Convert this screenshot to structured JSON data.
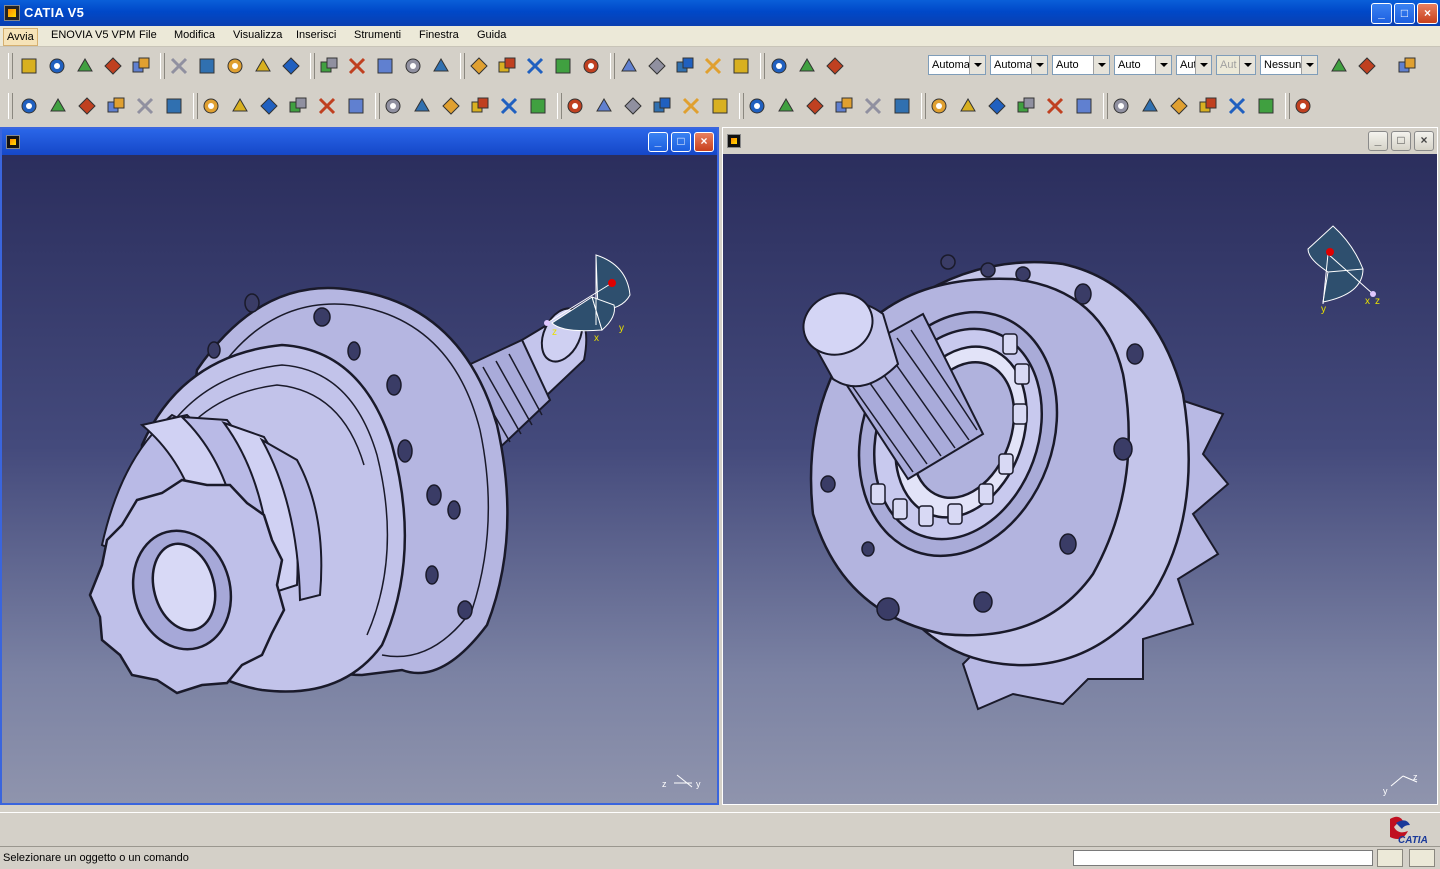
{
  "window": {
    "title": "CATIA V5"
  },
  "menu": {
    "items": [
      "Avvia",
      "ENOVIA V5 VPM",
      "File",
      "Modifica",
      "Visualizza",
      "Inserisci",
      "Strumenti",
      "Finestra",
      "Guida"
    ],
    "active": "Avvia"
  },
  "toolbar1": {
    "icons": [
      "gear-icon",
      "gears-icon",
      "catalog-icon",
      "manikin-icon",
      "manikin-group-icon",
      "new-icon",
      "open-icon",
      "save-icon",
      "print-icon",
      "cut-icon",
      "copy-icon",
      "paste-icon",
      "undo-icon",
      "redo-icon",
      "whats-this-icon",
      "camera-icon",
      "fly-mode-icon",
      "fit-all-icon",
      "pan-icon",
      "rotate-icon",
      "zoom-in-icon",
      "zoom-out-icon",
      "normal-view-icon",
      "multi-view-icon",
      "iso-view-icon",
      "shading-icon",
      "hide-show-icon",
      "swap-visible-icon"
    ],
    "combos": [
      {
        "value": "Automa",
        "disabled": false
      },
      {
        "value": "Automa",
        "disabled": false
      },
      {
        "value": "Auto",
        "disabled": false
      },
      {
        "value": "Auto",
        "disabled": false
      },
      {
        "value": "Aut",
        "disabled": false
      },
      {
        "value": "Aut",
        "disabled": true
      },
      {
        "value": "Nessunc",
        "disabled": false
      }
    ],
    "right_icons": [
      "painter-icon",
      "copy-format-icon",
      "layers-icon"
    ]
  },
  "toolbar2": {
    "icons": [
      "select-icon",
      "sketch-icon",
      "part-body-icon",
      "measure-icon",
      "constraint-icon",
      "bottle-icon",
      "publish-icon",
      "pad-icon",
      "pocket-icon",
      "shaft-icon",
      "groove-icon",
      "hole-icon",
      "rib-icon",
      "slot-icon",
      "stiffener-icon",
      "loft-icon",
      "remove-loft-icon",
      "edge-fillet-icon",
      "chamfer-icon",
      "draft-icon",
      "shell-icon",
      "thickness-icon",
      "thread-icon",
      "surface-cut-icon",
      "split-icon",
      "thick-surface-icon",
      "close-surface-icon",
      "sew-surface-icon",
      "translate-icon",
      "mirror-icon",
      "pattern-icon",
      "scale-icon",
      "point-icon",
      "line-icon",
      "plane-icon",
      "update-icon",
      "reframe-icon",
      "axis-system-icon",
      "formula-icon",
      "catalog-browser-icon",
      "sensor-icon",
      "law-icon",
      "material-icon"
    ]
  },
  "windows": [
    {
      "id": "left",
      "active": true,
      "axis": {
        "x": "x",
        "y": "y",
        "z": "z"
      },
      "corner_axis": [
        "z",
        "y"
      ]
    },
    {
      "id": "right",
      "active": false,
      "axis": {
        "x": "x",
        "y": "y",
        "z": "z"
      },
      "corner_axis": [
        "y",
        "z"
      ]
    }
  ],
  "window_buttons": {
    "minimize": "_",
    "maximize": "□",
    "close": "×"
  },
  "brand": {
    "logo_text": "CATIA"
  },
  "status": {
    "message": "Selezionare un oggetto o un comando",
    "command_value": ""
  },
  "colors": {
    "accent": "#0a5fd9",
    "viewport_top": "#2b2e5d",
    "viewport_bottom": "#8f94ad",
    "model": "#bbbce4"
  }
}
